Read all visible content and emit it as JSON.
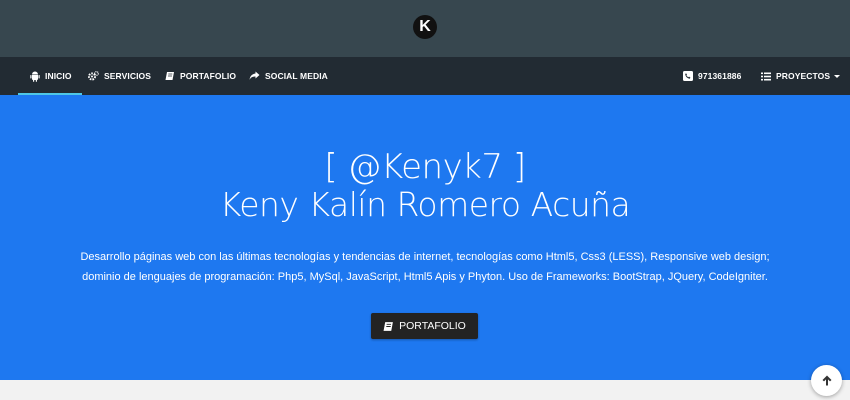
{
  "header": {
    "logo_letter": "K"
  },
  "nav": {
    "items": [
      {
        "label": "INICIO",
        "icon": "android-icon"
      },
      {
        "label": "SERVICIOS",
        "icon": "gears-icon"
      },
      {
        "label": "PORTAFOLIO",
        "icon": "book-icon"
      },
      {
        "label": "SOCIAL MEDIA",
        "icon": "share-icon"
      }
    ],
    "phone": {
      "label": "971361886",
      "icon": "phone-icon"
    },
    "projects": {
      "label": "PROYECTOS",
      "icon": "list-icon"
    }
  },
  "hero": {
    "handle": "[ @Kenyk7 ]",
    "name": "Keny Kalín Romero Acuña",
    "description": "Desarrollo páginas web con las últimas tecnologías y tendencias de internet, tecnologías como Html5, Css3 (LESS), Responsive web design; dominio de lenguajes de programación: Php5, MySql, JavaScript, Html5 Apis y Phyton. Uso de Frameworks: BootStrap, JQuery, CodeIgniter.",
    "cta_label": "PORTAFOLIO"
  },
  "colors": {
    "topbar": "#37474f",
    "navbar": "#222b33",
    "hero": "#1e78f0",
    "active_underline": "#4ec7e6",
    "cta": "#232323"
  }
}
